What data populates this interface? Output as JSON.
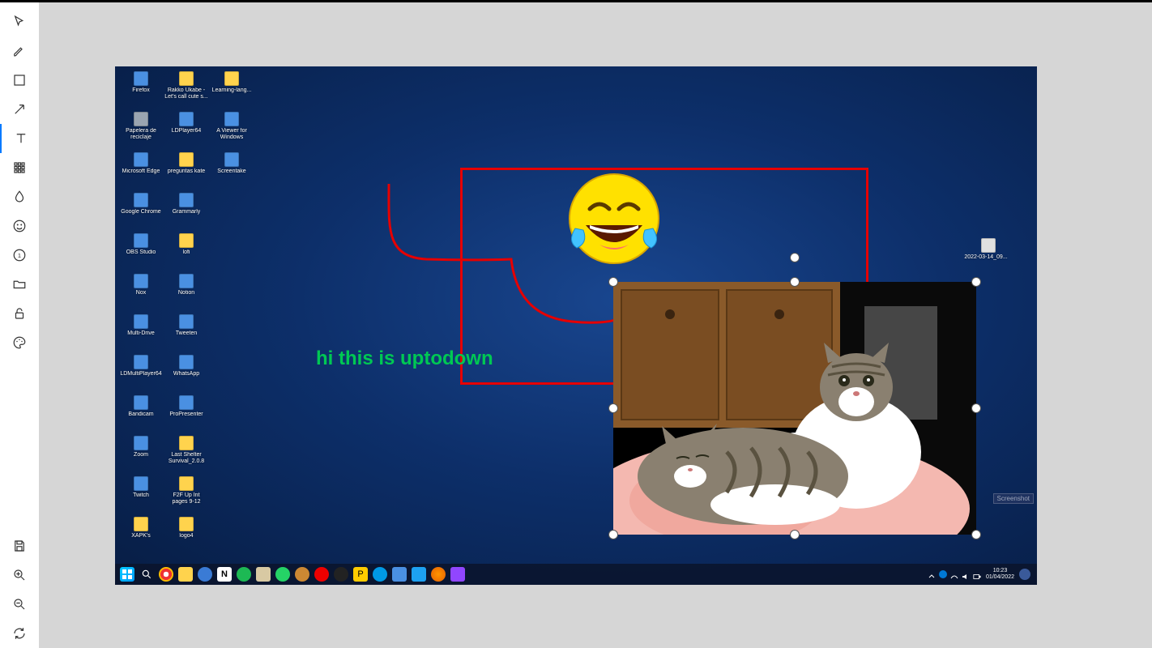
{
  "toolbar": {
    "tools": [
      {
        "name": "cursor-tool",
        "icon": "cursor-icon"
      },
      {
        "name": "brush-tool",
        "icon": "brush-icon"
      },
      {
        "name": "rectangle-tool",
        "icon": "square-icon"
      },
      {
        "name": "arrow-tool",
        "icon": "arrow-icon"
      },
      {
        "name": "text-tool",
        "icon": "text-icon",
        "active": true
      },
      {
        "name": "mosaic-tool",
        "icon": "grid-icon"
      },
      {
        "name": "blur-tool",
        "icon": "drop-icon"
      },
      {
        "name": "emoji-tool",
        "icon": "smiley-icon"
      },
      {
        "name": "counter-tool",
        "icon": "counter-icon"
      },
      {
        "name": "open-image-tool",
        "icon": "folder-icon"
      },
      {
        "name": "lock-tool",
        "icon": "lock-icon"
      },
      {
        "name": "palette-tool",
        "icon": "palette-icon"
      }
    ],
    "bottom_tools": [
      {
        "name": "save-tool",
        "icon": "save-icon"
      },
      {
        "name": "zoom-in-tool",
        "icon": "zoom-in-icon"
      },
      {
        "name": "zoom-out-tool",
        "icon": "zoom-out-icon"
      },
      {
        "name": "refresh-tool",
        "icon": "refresh-icon"
      }
    ]
  },
  "annotations": {
    "text": "hi this is uptodown",
    "emoji_name": "laughing-tears-emoji"
  },
  "desktop": {
    "rows": [
      [
        {
          "label": "Firefox",
          "type": "app"
        },
        {
          "label": "Rakko Ukabe - Let's call cute s...",
          "type": "folder"
        },
        {
          "label": "Learning-lang...",
          "type": "folder"
        }
      ],
      [
        {
          "label": "Papelera de reciclaje",
          "type": "bin"
        },
        {
          "label": "LDPlayer64",
          "type": "app"
        },
        {
          "label": "A Viewer for Windows",
          "type": "app"
        }
      ],
      [
        {
          "label": "Microsoft Edge",
          "type": "app"
        },
        {
          "label": "preguntas kate",
          "type": "folder"
        },
        {
          "label": "Screentake",
          "type": "app"
        }
      ],
      [
        {
          "label": "Google Chrome",
          "type": "app"
        },
        {
          "label": "Grammarly",
          "type": "app"
        }
      ],
      [
        {
          "label": "OBS Studio",
          "type": "app"
        },
        {
          "label": "lofi",
          "type": "folder"
        }
      ],
      [
        {
          "label": "Nox",
          "type": "app"
        },
        {
          "label": "Notion",
          "type": "app"
        }
      ],
      [
        {
          "label": "Multi-Drive",
          "type": "app"
        },
        {
          "label": "Tweeten",
          "type": "app"
        }
      ],
      [
        {
          "label": "LDMultiPlayer64",
          "type": "app"
        },
        {
          "label": "WhatsApp",
          "type": "app"
        }
      ],
      [
        {
          "label": "Bandicam",
          "type": "app"
        },
        {
          "label": "ProPresenter",
          "type": "app"
        }
      ],
      [
        {
          "label": "Zoom",
          "type": "app"
        },
        {
          "label": "Last Shelter Survival_2.0.8",
          "type": "folder"
        }
      ],
      [
        {
          "label": "Twitch",
          "type": "app"
        },
        {
          "label": "F2F Up Int pages 9-12",
          "type": "folder"
        }
      ],
      [
        {
          "label": "XAPK's",
          "type": "folder"
        },
        {
          "label": "logo4",
          "type": "folder"
        }
      ]
    ],
    "right_file_label": "2022-03-14_09...",
    "watermark": "Screenshot",
    "taskbar": {
      "time": "10:23",
      "date": "01/04/2022"
    }
  }
}
